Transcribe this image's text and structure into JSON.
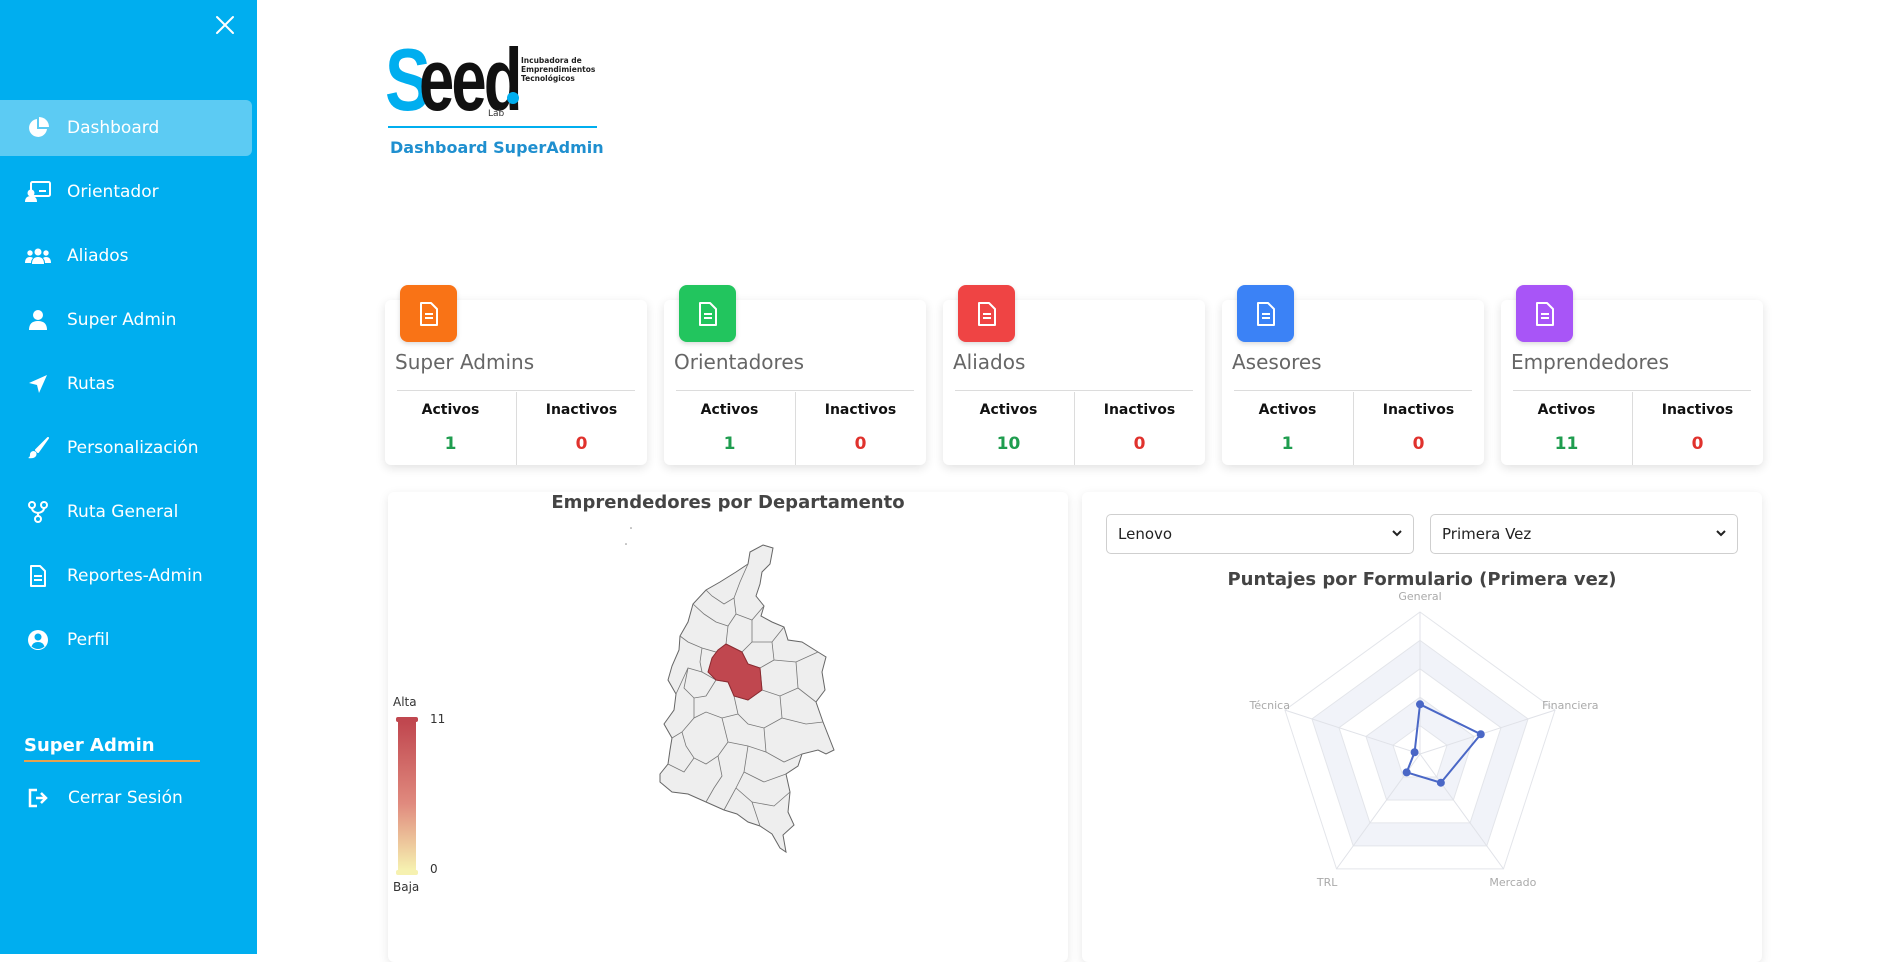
{
  "sidebar": {
    "items": [
      {
        "label": "Dashboard",
        "icon": "pie-chart-icon",
        "active": true
      },
      {
        "label": "Orientador",
        "icon": "monitor-user-icon"
      },
      {
        "label": "Aliados",
        "icon": "users-icon"
      },
      {
        "label": "Super Admin",
        "icon": "user-icon"
      },
      {
        "label": "Rutas",
        "icon": "location-arrow-icon"
      },
      {
        "label": "Personalización",
        "icon": "brush-icon"
      },
      {
        "label": "Ruta General",
        "icon": "fork-icon"
      },
      {
        "label": "Reportes-Admin",
        "icon": "document-icon"
      },
      {
        "label": "Perfil",
        "icon": "user-circle-icon"
      }
    ],
    "role_title": "Super Admin",
    "logout_label": "Cerrar Sesión",
    "colors": {
      "background": "#00aeef",
      "active": "#5ccbf3",
      "underline": "#e5a24f"
    }
  },
  "logo": {
    "wordmark_s": "S",
    "wordmark_rest": "eed",
    "tagline": "Incubadora de Emprendimientos Tecnológicos",
    "sub": "Lab"
  },
  "header": {
    "title": "Dashboard SuperAdmin"
  },
  "stats": [
    {
      "title": "Super Admins",
      "color": "#f97316",
      "active_label": "Activos",
      "inactive_label": "Inactivos",
      "active": "1",
      "inactive": "0"
    },
    {
      "title": "Orientadores",
      "color": "#22c55e",
      "active_label": "Activos",
      "inactive_label": "Inactivos",
      "active": "1",
      "inactive": "0"
    },
    {
      "title": "Aliados",
      "color": "#ef4444",
      "active_label": "Activos",
      "inactive_label": "Inactivos",
      "active": "10",
      "inactive": "0"
    },
    {
      "title": "Asesores",
      "color": "#3b82f6",
      "active_label": "Activos",
      "inactive_label": "Inactivos",
      "active": "1",
      "inactive": "0"
    },
    {
      "title": "Emprendedores",
      "color": "#a855f7",
      "active_label": "Activos",
      "inactive_label": "Inactivos",
      "active": "11",
      "inactive": "0"
    }
  ],
  "map": {
    "title": "Emprendedores por Departamento",
    "legend_high_label": "Alta",
    "legend_low_label": "Baja",
    "legend_max": "11",
    "legend_min": "0",
    "highlight_color": "#c0474f"
  },
  "radar": {
    "select_company": "Lenovo",
    "select_round": "Primera Vez",
    "title": "Puntajes por Formulario (Primera vez)",
    "line_color": "#4a67c6"
  },
  "chart_data": {
    "type": "radar",
    "title": "Puntajes por Formulario (Primera vez)",
    "axes": [
      "General",
      "Financiera",
      "Mercado",
      "TRL",
      "Técnica"
    ],
    "values": [
      0.35,
      0.45,
      0.25,
      0.16,
      0.04
    ],
    "range": [
      0,
      1
    ],
    "grid_levels": 5
  }
}
